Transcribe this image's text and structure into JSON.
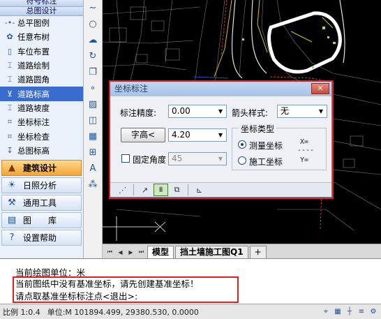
{
  "palette": {
    "top_category": "符号标注",
    "category": "总图设计",
    "tools": [
      {
        "icon": "polyline-legend-icon",
        "glyph": "-•-",
        "label": "总平图例"
      },
      {
        "icon": "tree-icon",
        "glyph": "✿",
        "label": "任意布树"
      },
      {
        "icon": "parking-icon",
        "glyph": "▯",
        "label": "车位布置"
      },
      {
        "icon": "road-draw-icon",
        "glyph": "⌶",
        "label": "道路绘制"
      },
      {
        "icon": "road-corner-icon",
        "glyph": "⌶",
        "label": "道路圆角"
      },
      {
        "icon": "road-elevation-icon",
        "glyph": "⊻",
        "label": "道路标高"
      },
      {
        "icon": "road-slope-icon",
        "glyph": "⌶",
        "label": "道路坡度"
      },
      {
        "icon": "coordinate-mark-icon",
        "glyph": "⌗",
        "label": "坐标标注"
      },
      {
        "icon": "coordinate-check-icon",
        "glyph": "⌗",
        "label": "坐标检查"
      },
      {
        "icon": "general-elevation-icon",
        "glyph": "↧",
        "label": "总图标高"
      }
    ],
    "selected_tool_index": 5,
    "groups": [
      {
        "icon": "building-icon",
        "glyph": "▲",
        "label": "建筑设计",
        "active": true
      },
      {
        "icon": "sunlight-icon",
        "glyph": "☀",
        "label": "日照分析",
        "active": false
      },
      {
        "icon": "tools-icon",
        "glyph": "⚒",
        "label": "通用工具",
        "active": false
      },
      {
        "icon": "library-icon",
        "glyph": "▤",
        "label": "图　　库",
        "active": false
      },
      {
        "icon": "help-icon",
        "glyph": "?",
        "label": "设置帮助",
        "active": false
      }
    ]
  },
  "vtoolbar": [
    {
      "icon": "spline-icon",
      "glyph": "∼"
    },
    {
      "icon": "circle-icon",
      "glyph": "○"
    },
    {
      "icon": "revcloud-icon",
      "glyph": "☁"
    },
    {
      "icon": "rotate-icon",
      "glyph": "↻"
    },
    {
      "icon": "copy-icon",
      "glyph": "❐"
    },
    {
      "icon": "point-icon",
      "glyph": "∘"
    },
    {
      "icon": "hatch-icon",
      "glyph": "▨"
    },
    {
      "icon": "region-icon",
      "glyph": "◫"
    },
    {
      "icon": "table-icon",
      "glyph": "▦"
    },
    {
      "icon": "block-icon",
      "glyph": "⊞"
    },
    {
      "icon": "text-icon",
      "glyph": "A"
    },
    {
      "icon": "multileader-icon",
      "glyph": "⁂"
    }
  ],
  "tabs": {
    "nav_glyphs": [
      "⏮",
      "◀",
      "▶",
      "⏭"
    ],
    "items": [
      "模型",
      "挡土墙施工图Q1",
      "+"
    ],
    "active_index": 0
  },
  "dialog": {
    "title": "坐标标注",
    "close_glyph": "✕",
    "precision_label": "标注精度:",
    "precision_value": "0.00",
    "arrow_label": "箭头样式:",
    "arrow_value": "无",
    "text_height_button": "字高<",
    "text_height_value": "4.20",
    "fixed_angle_label": "固定角度",
    "fixed_angle_value": "45",
    "fixed_angle_checked": false,
    "coord_type_title": "坐标类型",
    "coord_types": [
      {
        "label": "测量坐标",
        "selected": true,
        "sample": "X="
      },
      {
        "label": "施工坐标",
        "selected": false,
        "sample": "Y="
      }
    ],
    "sample_dashes": "----",
    "toolbar": [
      {
        "icon": "hatch-select-icon",
        "glyph": "⋰"
      },
      {
        "icon": "pick-point-icon",
        "glyph": "↗"
      },
      {
        "icon": "batch-mark-icon",
        "glyph": "⩩"
      },
      {
        "icon": "window-select-icon",
        "glyph": "⧉"
      },
      {
        "icon": "axis-icon",
        "glyph": "⊾"
      }
    ],
    "toolbar_active_index": 2
  },
  "command": {
    "partial_line": "",
    "lines": [
      "当前绘图单位：米",
      "当前图纸中没有基准坐标，请先创建基准坐标！",
      "请点取基准坐标标注点<退出>:"
    ]
  },
  "status": {
    "scale": "比例 1:0.4",
    "unit_coords": "单位:M  101894.499,  29380.530,  0.0000",
    "icons": [
      {
        "icon": "snap-icon",
        "glyph": "⌖"
      },
      {
        "icon": "grid-icon",
        "glyph": "▦"
      },
      {
        "icon": "ortho-icon",
        "glyph": "┼"
      },
      {
        "icon": "layer-icon",
        "glyph": "≡"
      },
      {
        "icon": "settings-icon",
        "glyph": "⚙"
      }
    ]
  },
  "colors": {
    "highlight": "#e02020",
    "palette_bg": "#eaf1fb",
    "selected": "#3a6cd0",
    "active_group": "#f3a43a"
  }
}
